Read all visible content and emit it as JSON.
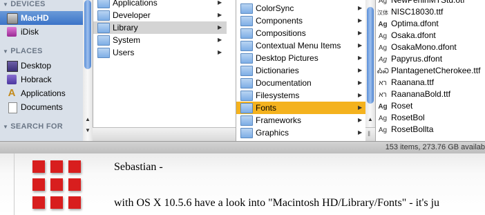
{
  "sidebar": {
    "devices_header": "DEVICES",
    "devices": [
      {
        "label": "MacHD",
        "icon": "hard-drive-icon",
        "selected": true
      },
      {
        "label": "iDisk",
        "icon": "idisk-icon",
        "selected": false
      }
    ],
    "places_header": "PLACES",
    "places": [
      {
        "label": "Desktop",
        "icon": "desktop-icon"
      },
      {
        "label": "Hobrack",
        "icon": "home-icon"
      },
      {
        "label": "Applications",
        "icon": "applications-icon"
      },
      {
        "label": "Documents",
        "icon": "documents-icon"
      }
    ],
    "search_header": "SEARCH FOR"
  },
  "column1": {
    "items": [
      {
        "label": "Applications"
      },
      {
        "label": "Developer"
      },
      {
        "label": "Library",
        "selected": true
      },
      {
        "label": "System"
      },
      {
        "label": "Users"
      }
    ]
  },
  "column2": {
    "items": [
      {
        "label": "ColorSync"
      },
      {
        "label": "Components"
      },
      {
        "label": "Compositions"
      },
      {
        "label": "Contextual Menu Items"
      },
      {
        "label": "Desktop Pictures"
      },
      {
        "label": "Dictionaries"
      },
      {
        "label": "Documentation"
      },
      {
        "label": "Filesystems"
      },
      {
        "label": "Fonts",
        "selected": true
      },
      {
        "label": "Frameworks"
      },
      {
        "label": "Graphics"
      }
    ]
  },
  "column3": {
    "items": [
      {
        "label": "NewPeninMTStd.otf",
        "glyph": "Ag"
      },
      {
        "label": "NISC18030.ttf",
        "glyph": "汉体"
      },
      {
        "label": "Optima.dfont",
        "glyph": "Ag"
      },
      {
        "label": "Osaka.dfont",
        "glyph": "Ag"
      },
      {
        "label": "OsakaMono.dfont",
        "glyph": "Ag"
      },
      {
        "label": "Papyrus.dfont",
        "glyph": "Ag"
      },
      {
        "label": "PlantagenetCherokee.ttf",
        "glyph": "ᎣᏍ"
      },
      {
        "label": "Raanana.ttf",
        "glyph": "רא"
      },
      {
        "label": "RaananaBold.ttf",
        "glyph": "רא"
      },
      {
        "label": "Roset",
        "glyph": "Ag"
      },
      {
        "label": "RosetBol",
        "glyph": "Ag"
      },
      {
        "label": "RosetBollta",
        "glyph": "Ag"
      }
    ]
  },
  "statusbar": {
    "text": "153 items, 273.76 GB availab"
  },
  "post": {
    "greeting": "Sebastian -",
    "body": "with OS X 10.5.6 have a look into \"Macintosh HD/Library/Fonts\" - it's ju"
  }
}
